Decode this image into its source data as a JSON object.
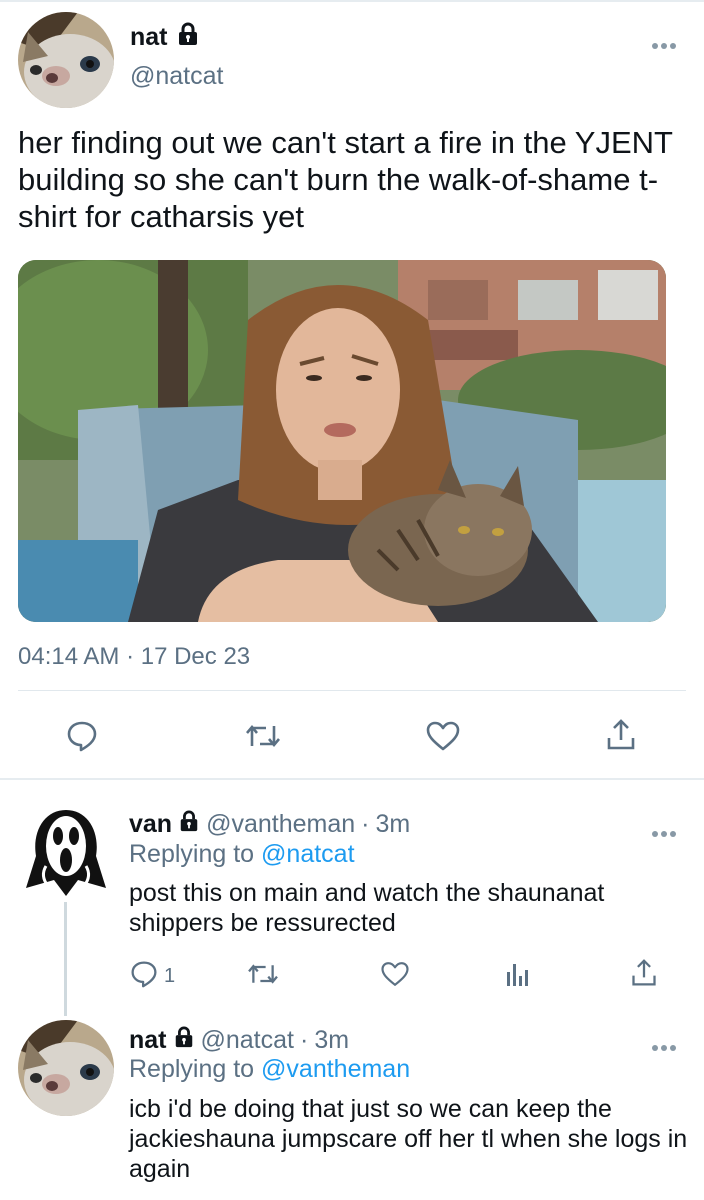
{
  "main_tweet": {
    "display_name": "nat",
    "handle": "@natcat",
    "text": "her finding out we can't start a fire in the YJENT building so she can't burn the walk-of-shame t-shirt for catharsis yet",
    "timestamp": "04:14 AM · 17 Dec 23",
    "more_icon": "more-horizontal-icon",
    "lock_icon": "lock-icon",
    "actions": [
      {
        "name": "reply",
        "icon": "speech-bubble-icon"
      },
      {
        "name": "retweet",
        "icon": "retweet-icon"
      },
      {
        "name": "like",
        "icon": "heart-icon"
      },
      {
        "name": "share",
        "icon": "share-icon"
      }
    ]
  },
  "replies": [
    {
      "display_name": "van",
      "handle": "@vantheman",
      "time": "3m",
      "replying_label": "Replying to",
      "replying_to": "@natcat",
      "text": "post this on main and watch the shaunanat shippers be ressurected",
      "reply_count": "1",
      "actions": [
        "speech-bubble-icon",
        "retweet-icon",
        "heart-icon",
        "bar-chart-icon",
        "share-icon"
      ]
    },
    {
      "display_name": "nat",
      "handle": "@natcat",
      "time": "3m",
      "replying_label": "Replying to",
      "replying_to": "@vantheman",
      "text": "icb i'd be doing that just so we can keep the jackieshauna jumpscare off her tl when she logs in again"
    }
  ],
  "colors": {
    "text": "#0f1419",
    "secondary": "#5b7083",
    "link": "#1d9bf0",
    "divider": "#e1e8ed"
  }
}
